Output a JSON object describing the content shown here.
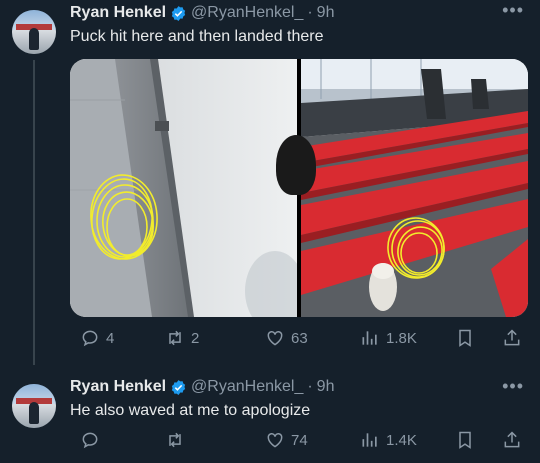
{
  "tweets": [
    {
      "author_name": "Ryan Henkel",
      "handle": "@RyanHenkel_",
      "separator": "·",
      "time": "9h",
      "more": "•••",
      "text": "Puck hit here and then landed there",
      "media_count": 2,
      "actions": {
        "replies": "4",
        "retweets": "2",
        "likes": "63",
        "views": "1.8K"
      }
    },
    {
      "author_name": "Ryan Henkel",
      "handle": "@RyanHenkel_",
      "separator": "·",
      "time": "9h",
      "more": "•••",
      "text": "He also waved at me to apologize",
      "actions": {
        "replies": "",
        "retweets": "",
        "likes": "74",
        "views": "1.4K"
      }
    }
  ],
  "colors": {
    "background": "#15202b",
    "text": "#e7e9ea",
    "secondary": "#8b98a5",
    "verified": "#1d9bf0",
    "circle": "#f2ec2c",
    "seat_red": "#d92b31"
  },
  "icons": [
    "reply-icon",
    "retweet-icon",
    "like-icon",
    "views-icon",
    "bookmark-icon",
    "share-icon",
    "verified-badge-icon",
    "more-icon"
  ]
}
